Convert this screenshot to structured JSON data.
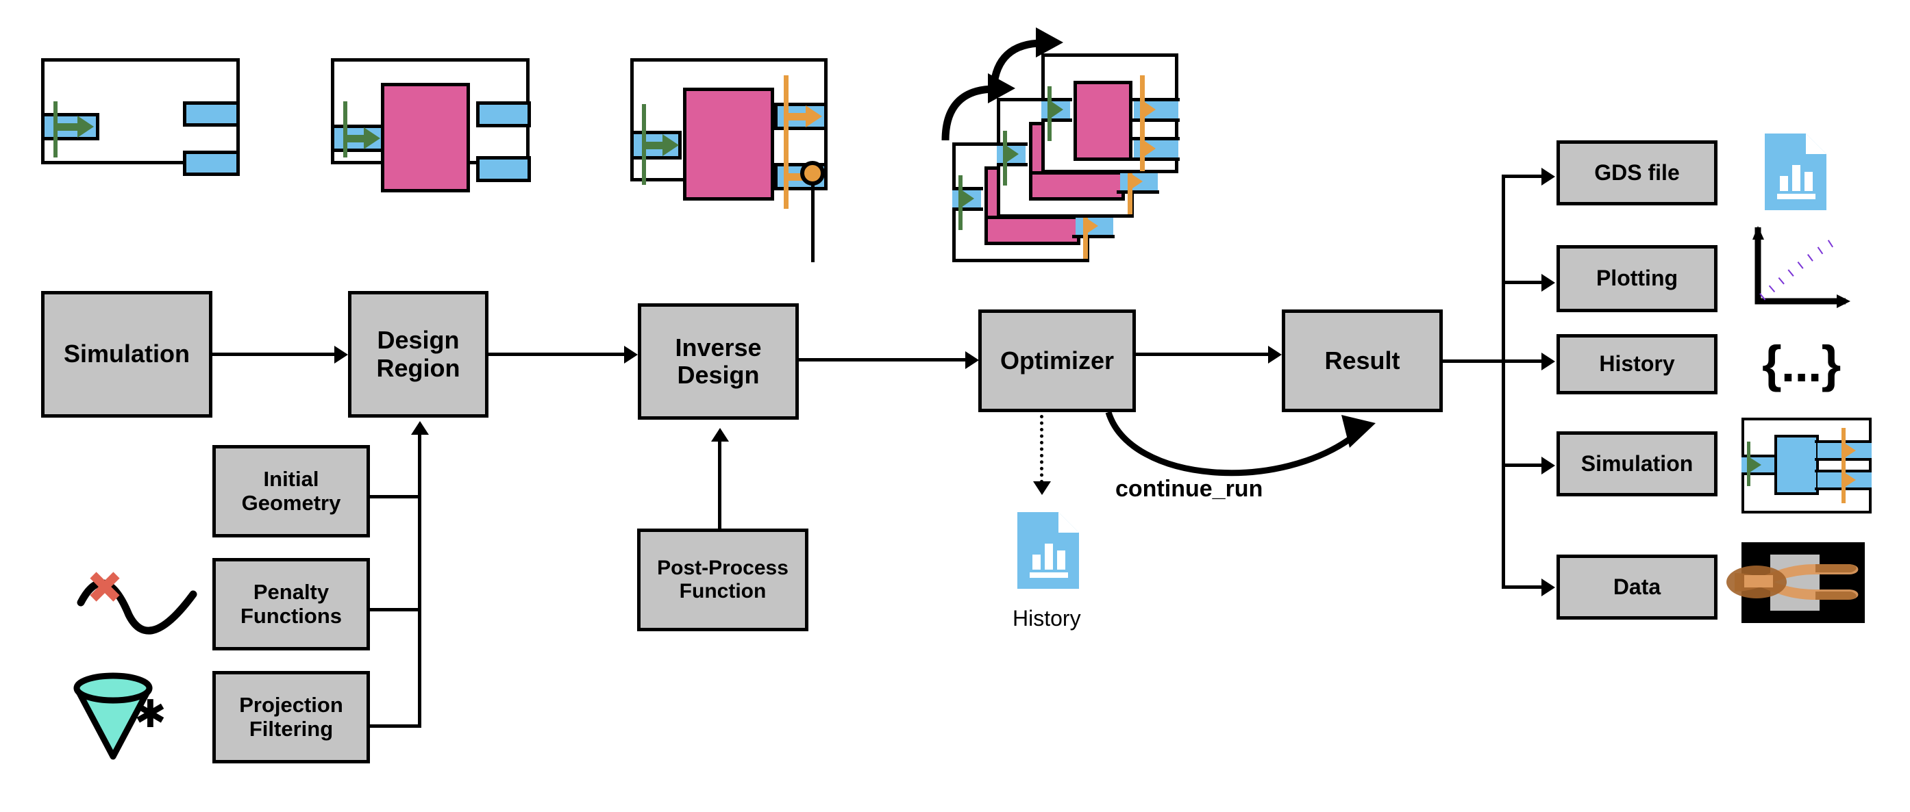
{
  "flow": {
    "simulation": "Simulation",
    "design_region": "Design\nRegion",
    "inverse_design": "Inverse\nDesign",
    "optimizer": "Optimizer",
    "result": "Result",
    "continue_run": "continue_run",
    "history_caption": "History"
  },
  "design_inputs": [
    {
      "label": "Initial\nGeometry"
    },
    {
      "label": "Penalty\nFunctions"
    },
    {
      "label": "Projection\nFiltering"
    }
  ],
  "inverse_inputs": [
    {
      "label": "Post-Process\nFunction"
    }
  ],
  "outputs": [
    {
      "label": "GDS file",
      "icon": "bar-chart-file-icon"
    },
    {
      "label": "Plotting",
      "icon": "line-plot-icon"
    },
    {
      "label": "History",
      "icon": "json-braces-icon"
    },
    {
      "label": "Simulation",
      "icon": "simulation-thumbnail-icon"
    },
    {
      "label": "Data",
      "icon": "field-heatmap-icon"
    }
  ],
  "icons": {
    "json_braces": "{...}",
    "convolution_star": "✱",
    "penalty_cross": "penalty-x-icon",
    "penalty_curve": "penalty-curve-icon",
    "cone_filter": "cone-filter-icon"
  },
  "colors": {
    "box_fill": "#c4c4c4",
    "box_border": "#000000",
    "design_region_pink": "#dd5e9b",
    "waveguide_blue": "#74c0ec",
    "source_green": "#4a7c42",
    "monitor_orange": "#e79c3f",
    "file_icon_blue": "#74c0ec",
    "plot_curve_purple": "#7b35d6",
    "cone_teal": "#7ae8d5",
    "cross_red": "#e06352"
  }
}
